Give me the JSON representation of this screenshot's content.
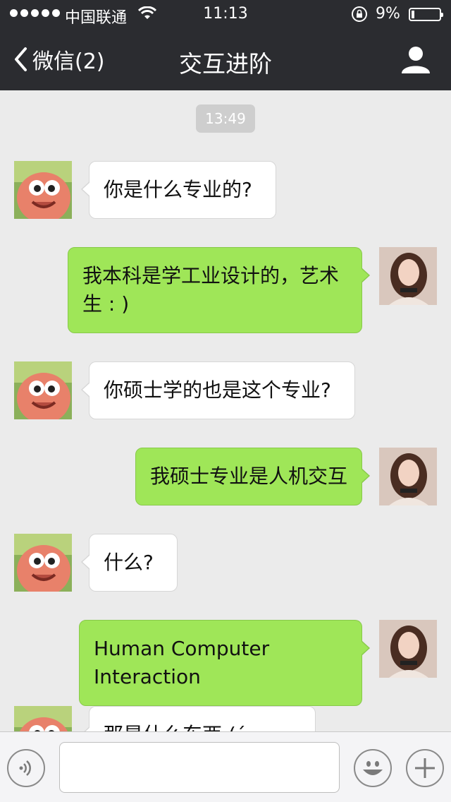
{
  "status_bar": {
    "carrier": "中国联通",
    "time": "11:13",
    "battery_percent": "9%",
    "battery_level": 0.09,
    "signal_bars": 5
  },
  "nav": {
    "back_label": "微信(2)",
    "title": "交互进阶",
    "profile_icon": "person-icon"
  },
  "chat": {
    "timestamp": "13:49",
    "messages": [
      {
        "side": "in",
        "text": "你是什么专业的?"
      },
      {
        "side": "out",
        "text": "我本科是学工业设计的，艺术生 : )"
      },
      {
        "side": "in",
        "text": "你硕士学的也是这个专业?"
      },
      {
        "side": "out",
        "text": "我硕士专业是人机交互"
      },
      {
        "side": "in",
        "text": "什么?"
      },
      {
        "side": "out",
        "text": "Human Computer Interaction"
      },
      {
        "side": "in",
        "text": "那是什么东西 (´･_･`)?"
      }
    ]
  },
  "input_bar": {
    "voice_icon": "voice-icon",
    "text_value": "",
    "emoji_icon": "emoji-icon",
    "plus_icon": "plus-icon"
  },
  "colors": {
    "nav_bg": "#2b2c30",
    "chat_bg": "#ebebeb",
    "outgoing_bubble": "#9fe658",
    "incoming_bubble": "#ffffff"
  }
}
